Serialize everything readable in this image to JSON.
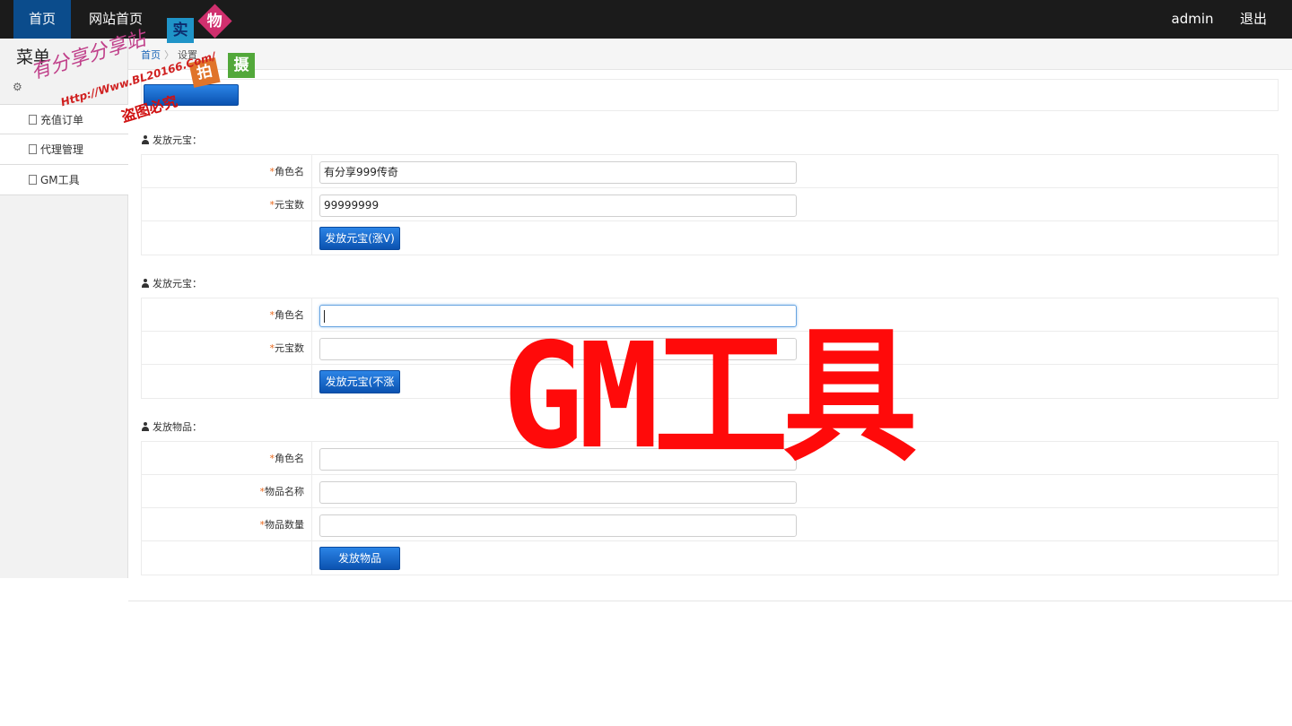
{
  "topbar": {
    "home_label": "首页",
    "site_label": "网站首页",
    "user_label": "admin",
    "logout_label": "退出"
  },
  "sidebar": {
    "title": "菜单",
    "items": [
      {
        "label": "充值订单"
      },
      {
        "label": "代理管理"
      },
      {
        "label": "GM工具"
      }
    ]
  },
  "breadcrumb": {
    "home": "首页",
    "current": "设置"
  },
  "sections": [
    {
      "title": "发放元宝：",
      "fields": [
        {
          "label": "角色名",
          "value": ""
        },
        {
          "label": "元宝数",
          "value": "99999999"
        }
      ],
      "button": "发放元宝(涨V)"
    },
    {
      "title": "发放元宝：",
      "fields": [
        {
          "label": "角色名",
          "value": ""
        },
        {
          "label": "元宝数",
          "value": ""
        }
      ],
      "button": "发放元宝(不涨V)"
    },
    {
      "title": "发放物品：",
      "fields": [
        {
          "label": "角色名",
          "value": ""
        },
        {
          "label": "物品名称",
          "value": ""
        },
        {
          "label": "物品数量",
          "value": ""
        }
      ],
      "button": "发放物品"
    }
  ],
  "first_role_value": "有分享999传奇",
  "overlay_text": "GM工具",
  "watermark": {
    "square1": "实",
    "square2": "物",
    "square3": "拍",
    "square4": "摄",
    "line1": "有分享分享站",
    "line2": "Http://Www.BL20166.Com/",
    "line3": "盗图必究"
  },
  "colors": {
    "topbar_bg": "#1b1b1b",
    "active_nav": "#0b4c8c",
    "button_blue": "#0b52b0",
    "required_star": "#e8661a",
    "overlay_red": "#ff0a0a"
  }
}
